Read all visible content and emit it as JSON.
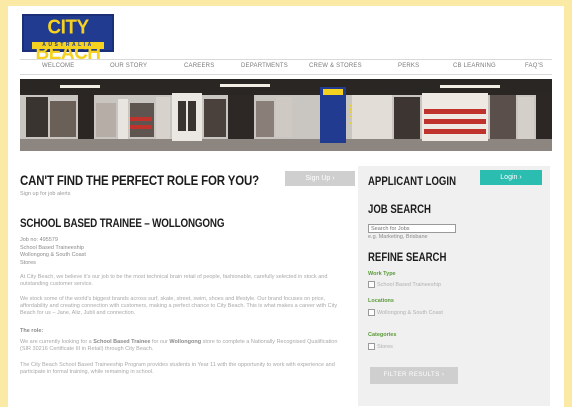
{
  "brand": {
    "name": "CITY BEACH",
    "sub": "AUSTRALIA",
    "primary": "#213b91",
    "yellow": "#f4d21f"
  },
  "nav": [
    {
      "label": "WELCOME"
    },
    {
      "label": "OUR STORY"
    },
    {
      "label": "CAREERS"
    },
    {
      "label": "DEPARTMENTS"
    },
    {
      "label": "CREW & STORES"
    },
    {
      "label": "PERKS"
    },
    {
      "label": "CB LEARNING"
    },
    {
      "label": "FAQ'S"
    }
  ],
  "hero": {
    "sign": "CITY"
  },
  "main": {
    "headline": "CAN'T FIND THE PERFECT ROLE FOR YOU?",
    "signup_label": "Sign Up",
    "signup_sub": "Sign up for job alerts",
    "job_title": "SCHOOL BASED TRAINEE – WOLLONGONG",
    "job_ref": "Job no: 495579",
    "job_type": "School Based Traineeship",
    "job_location": "Wollongong & South Coast",
    "job_dept": "Stores",
    "para1": "At City Beach, we believe it's our job to be the most technical brain retail of people, fashionable, carefully selected in stock and outstanding customer service.",
    "para2": "We stock some of the world's biggest brands across surf, skate, street, swim, shoes and lifestyle. Our brand focuses on price, affordability and creating connection with customers, making a perfect chance to City Beach. This is what makes a career with City Beach for us – Jane, Aliz, Jubli and connection.",
    "role_label": "The role:",
    "para3_pre": "We are currently looking for a ",
    "para3_b1": "School Based Trainee",
    "para3_mid": " for our ",
    "para3_b2": "Wollongong",
    "para3_post": " store to complete a Nationally Recognised Qualification (SIR 30216 Certificate III in Retail) through City Beach.",
    "para4": "The City Beach School Based Traineeship Program provides students in Year 11 with the opportunity to work with experience and participate in formal training, while remaining in school."
  },
  "sidebar": {
    "login_heading": "APPLICANT LOGIN",
    "login_btn": "Login",
    "job_search_heading": "JOB SEARCH",
    "search_placeholder": "Search for Jobs",
    "search_hint": "e.g. Marketing, Brisbane",
    "refine_heading": "REFINE SEARCH",
    "work_type_label": "Work Type",
    "work_type_option": "School Based Traineeship",
    "locations_label": "Locations",
    "location_option": "Wollongong & South Coast",
    "categories_label": "Categories",
    "category_option": "Stores",
    "filter_btn": "FILTER RESULTS",
    "accent": "#2cbdb1"
  }
}
